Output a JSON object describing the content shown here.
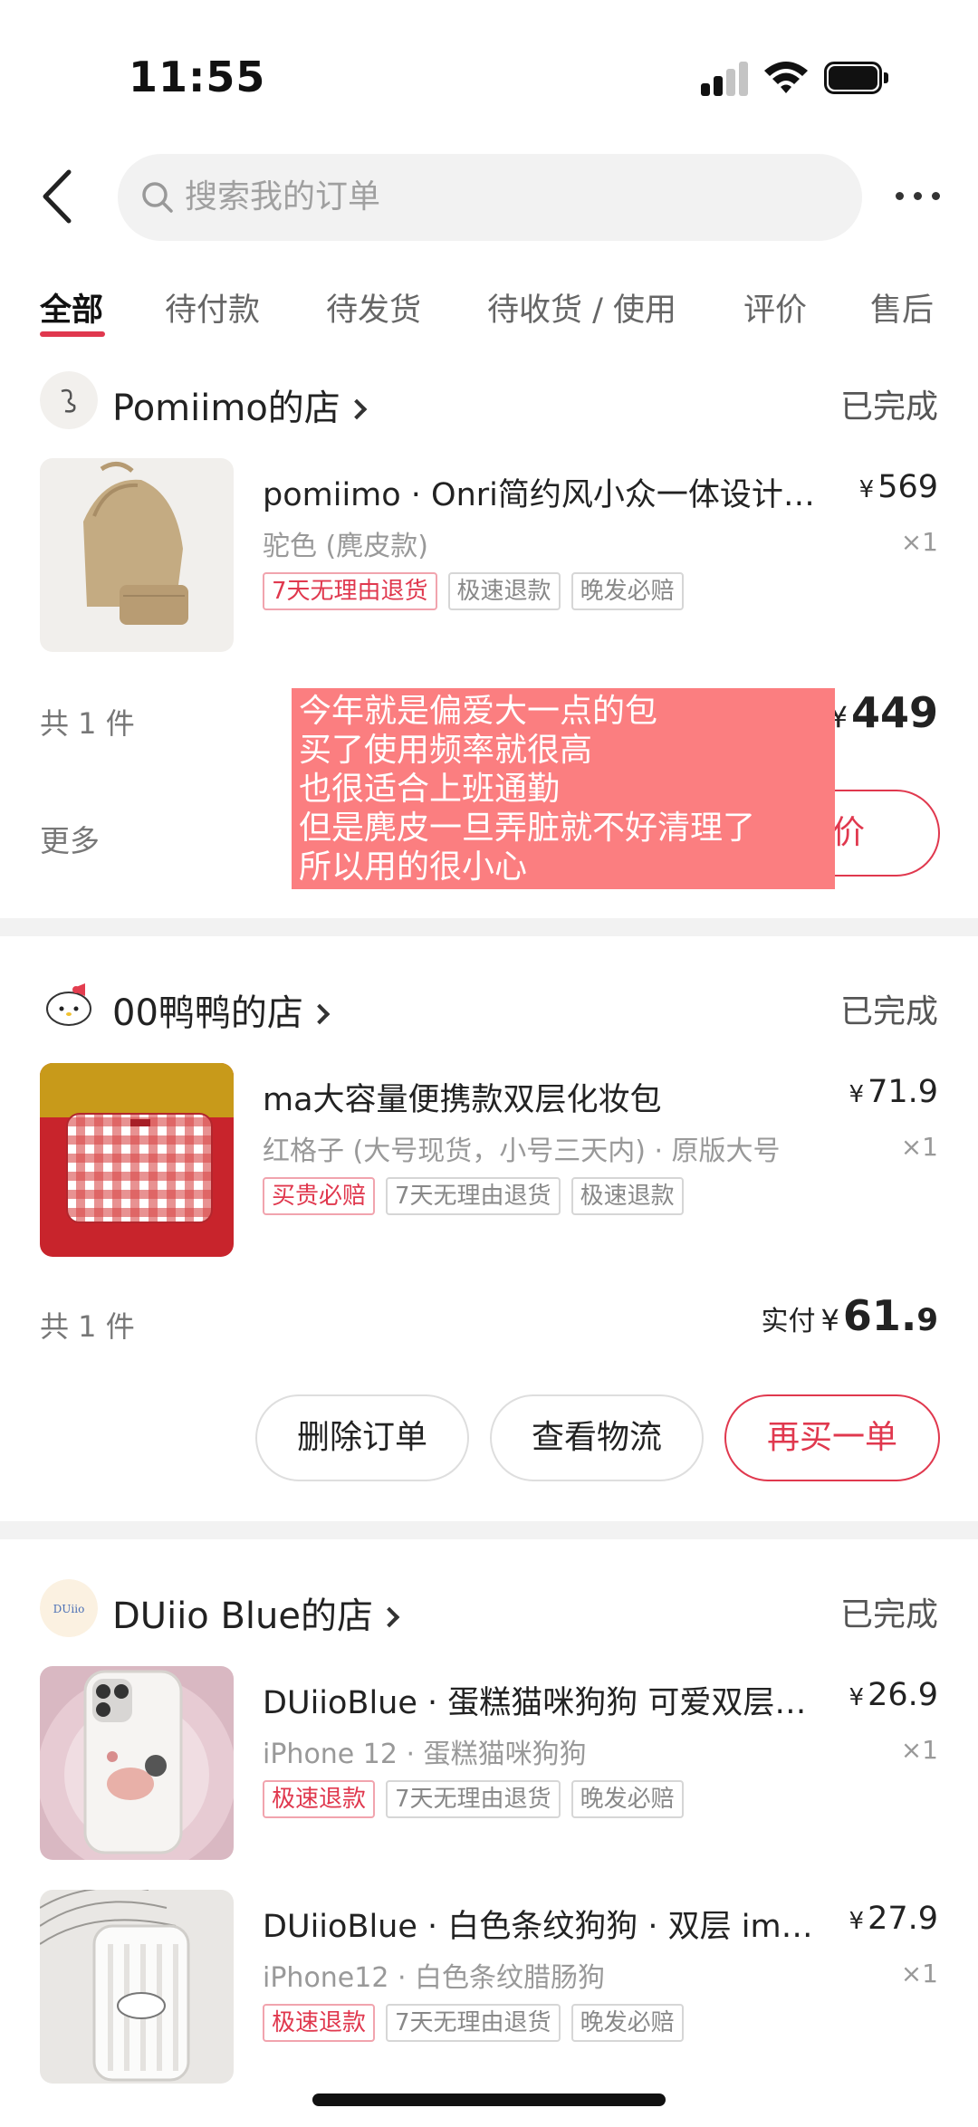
{
  "status_bar": {
    "time": "11:55"
  },
  "header": {
    "search_placeholder": "搜索我的订单"
  },
  "tabs": [
    {
      "label": "全部",
      "active": true
    },
    {
      "label": "待付款"
    },
    {
      "label": "待发货"
    },
    {
      "label": "待收货 / 使用"
    },
    {
      "label": "评价"
    },
    {
      "label": "售后"
    }
  ],
  "orders": [
    {
      "shop": "Pomiimo的店",
      "status": "已完成",
      "items": [
        {
          "title": "pomiimo · Onri简约风小众一体设计托特包",
          "price": "569",
          "sku": "驼色 (麂皮款)",
          "qty": "×1",
          "tags": [
            "7天无理由退货",
            "极速退款",
            "晚发必赔"
          ]
        }
      ],
      "count": "共 1 件",
      "total": "449",
      "more": "更多",
      "button": "评价"
    },
    {
      "shop": "00鸭鸭的店",
      "status": "已完成",
      "items": [
        {
          "title": "ma大容量便携款双层化妆包",
          "price": "71.9",
          "sku": "红格子 (大号现货，小号三天内) · 原版大号",
          "qty": "×1",
          "tags": [
            "买贵必赔",
            "7天无理由退货",
            "极速退款"
          ]
        }
      ],
      "count": "共 1 件",
      "pay_label": "实付",
      "total_int": "61.",
      "total_dec": "9",
      "buttons": [
        "删除订单",
        "查看物流",
        "再买一单"
      ]
    },
    {
      "shop": "DUiio Blue的店",
      "status": "已完成",
      "items": [
        {
          "title": "DUiioBlue · 蛋糕猫咪狗狗 可爱双层手机壳",
          "price": "26.9",
          "sku": "iPhone 12 · 蛋糕猫咪狗狗",
          "qty": "×1",
          "tags": [
            "极速退款",
            "7天无理由退货",
            "晚发必赔"
          ]
        },
        {
          "title": "DUiioBlue · 白色条纹狗狗 · 双层 imd 手机壳",
          "price": "27.9",
          "sku": "iPhone12 · 白色条纹腊肠狗",
          "qty": "×1",
          "tags": [
            "极速退款",
            "7天无理由退货",
            "晚发必赔"
          ]
        }
      ]
    }
  ],
  "overlay_note": [
    "今年就是偏爱大一点的包",
    "买了使用频率就很高",
    "也很适合上班通勤",
    "但是麂皮一旦弄脏就不好清理了",
    "所以用的很小心"
  ],
  "currency": "¥",
  "colors": {
    "accent": "#e0384e",
    "overlay": "#fb7e80"
  }
}
